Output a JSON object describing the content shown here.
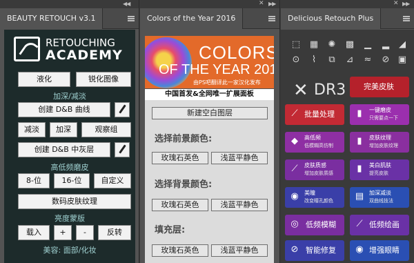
{
  "panel1": {
    "title": "BEAUTY RETOUCH v3.1",
    "logo_line1": "RETOUCHING",
    "logo_line2": "ACADEMY",
    "btn_liquify": "液化",
    "btn_sharpen": "锐化图像",
    "sec_dodge_burn": "加深/减淡",
    "btn_create_db_curve": "创建 D&B 曲线",
    "btn_dodge": "减淡",
    "btn_burn": "加深",
    "btn_observe": "观察组",
    "btn_create_db_gray": "创建 D&B 中灰层",
    "sec_freq": "高低频磨皮",
    "btn_8bit": "8-位",
    "btn_16bit": "16-位",
    "btn_custom": "自定义",
    "btn_digital_skin": "数码皮肤纹理",
    "sec_lum": "亮度蒙版",
    "btn_load": "载入",
    "btn_plus": "+",
    "btn_minus": "-",
    "btn_invert": "反转",
    "sec_beauty": "美容: 面部/化妆"
  },
  "panel2": {
    "title": "Colors of the Year 2016",
    "banner_line1": "COLORS",
    "banner_line2": "OF THE YEAR 2016",
    "banner_line3": "由PS吧翻译此一家汉化发布",
    "banner_bar": "中国首发&全网唯一扩展面板",
    "btn_new_layer": "新建空白图层",
    "label_fg": "选择前景颜色:",
    "btn_rose_fg": "玫瑰石英色",
    "btn_blue_fg": "浅蓝平静色",
    "label_bg": "选择背景颜色:",
    "btn_rose_bg": "玫瑰石英色",
    "btn_blue_bg": "浅蓝平静色",
    "label_fill": "填充层:",
    "btn_rose_fill": "玫瑰石英色",
    "btn_blue_fill": "浅蓝平静色"
  },
  "panel3": {
    "title": "Delicious Retouch Plus",
    "logo_text": "DR3",
    "buttons": [
      {
        "label": "完美皮肤",
        "sub": "",
        "color": "#b5212b"
      },
      {
        "label": "批量处理",
        "sub": "",
        "color": "#c22a34"
      },
      {
        "label": "一键磨皮",
        "sub": "只需要点一下",
        "color": "#9b2fae"
      },
      {
        "label": "高低频",
        "sub": "低模糊高仿制",
        "color": "#8e2fa3"
      },
      {
        "label": "皮肤纹理",
        "sub": "增加皮肤纹理",
        "color": "#8a2f9f"
      },
      {
        "label": "皮肤质感",
        "sub": "增加皮肤质感",
        "color": "#7a2ea0"
      },
      {
        "label": "美白肌肤",
        "sub": "提亮皮肤",
        "color": "#6a31a6"
      },
      {
        "label": "美瞳",
        "sub": "改变瞳孔颜色",
        "color": "#3a3fa8"
      },
      {
        "label": "加深减淡",
        "sub": "双曲线技法",
        "color": "#2a4fb3"
      },
      {
        "label": "低频模糊",
        "sub": "",
        "color": "#7a2ea0"
      },
      {
        "label": "低频绘画",
        "sub": "",
        "color": "#6a31a6"
      },
      {
        "label": "智能修复",
        "sub": "",
        "color": "#3a3fa8"
      },
      {
        "label": "增强眼睛",
        "sub": "",
        "color": "#2a4fb3"
      }
    ]
  }
}
